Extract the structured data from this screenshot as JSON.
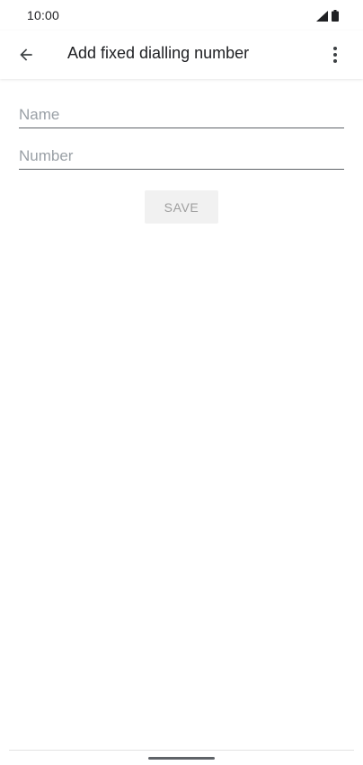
{
  "status_bar": {
    "time": "10:00",
    "icons": [
      "cellular-signal-icon",
      "battery-icon"
    ]
  },
  "app_bar": {
    "title": "Add fixed dialling number",
    "back_icon": "arrow-back-icon",
    "overflow_icon": "more-vert-icon"
  },
  "form": {
    "name_field": {
      "value": "",
      "placeholder": "Name"
    },
    "number_field": {
      "value": "",
      "placeholder": "Number"
    },
    "save_label": "SAVE"
  },
  "colors": {
    "background": "#ffffff",
    "text_primary": "#202124",
    "placeholder": "#9aa0a6",
    "underline": "#5f6368",
    "button_disabled_bg": "#f1f1f1",
    "button_disabled_text": "#9e9e9e"
  }
}
